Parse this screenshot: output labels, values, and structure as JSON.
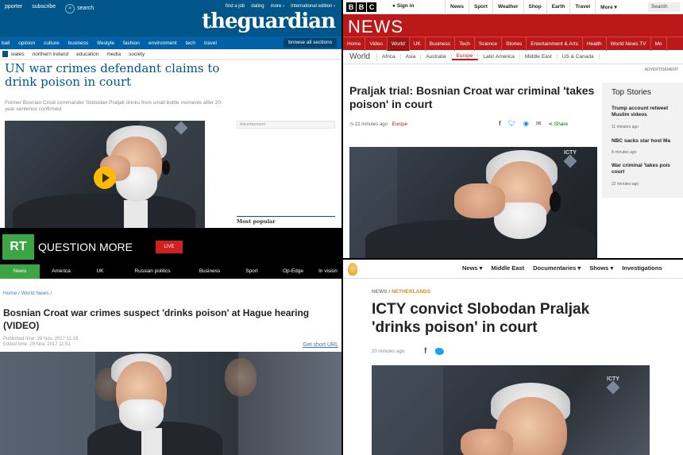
{
  "guardian": {
    "top_links": [
      "pporter",
      "subscribe",
      "search"
    ],
    "right_links": [
      "find a job",
      "dating",
      "more ›",
      "International edition ›"
    ],
    "logo": "theguardian",
    "nav": [
      "ball",
      "opinion",
      "culture",
      "business",
      "lifestyle",
      "fashion",
      "environment",
      "tech",
      "travel"
    ],
    "browse": "browse all sections",
    "subnav": [
      "wales",
      "northern ireland",
      "education",
      "media",
      "society"
    ],
    "headline": "UN war crimes defendant claims to drink poison in court",
    "standfirst": "Former Bosnian Croat commander Slobodan Praljak drinks from small bottle moments after 20-year sentence confirmed",
    "ad_label": "Advertisement",
    "most_popular": "Most popular"
  },
  "bbc": {
    "blocks": [
      "B",
      "B",
      "C"
    ],
    "signin": "Sign in",
    "top_links": [
      "News",
      "Sport",
      "Weather",
      "Shop",
      "Earth",
      "Travel",
      "More ▾"
    ],
    "search": "Search",
    "brand": "NEWS",
    "nav": [
      "Home",
      "Video",
      "World",
      "UK",
      "Business",
      "Tech",
      "Science",
      "Stories",
      "Entertainment & Arts",
      "Health",
      "World News TV",
      "Mo"
    ],
    "nav_active": "World",
    "section": "World",
    "subnav": [
      "Africa",
      "Asia",
      "Australia",
      "Europe",
      "Latin America",
      "Middle East",
      "US & Canada"
    ],
    "subnav_active": "Europe",
    "ad_label": "ADVERTISEMENT",
    "headline": "Praljak trial: Bosnian Croat war criminal 'takes poison' in court",
    "time": "22 minutes ago",
    "time_section": "Europe",
    "share": "Share",
    "top_stories_title": "Top Stories",
    "top_stories": [
      {
        "title": "Trump account retweet Muslim videos",
        "time": "11 minutes ago"
      },
      {
        "title": "NBC sacks star host Ma",
        "time": "8 minutes ago"
      },
      {
        "title": "War criminal 'takes pois court",
        "time": "22 minutes ago"
      }
    ],
    "watermark": "ICTY"
  },
  "rt": {
    "logo": "RT",
    "slogan": "QUESTION MORE",
    "live": "LIVE",
    "nav": [
      "News",
      "America",
      "UK",
      "Russian politics",
      "Business",
      "Sport",
      "Op-Edge",
      "In vision"
    ],
    "nav_active": "News",
    "breadcrumb": "Home / World News /",
    "headline": "Bosnian Croat war crimes suspect 'drinks poison' at Hague hearing (VIDEO)",
    "published": "Published time: 29 Nov, 2017 11:18",
    "edited": "Edited time: 29 Nov, 2017 11:51",
    "short_url": "Get short URL"
  },
  "aljazeera": {
    "nav": [
      "News ▾",
      "Middle East",
      "Documentaries ▾",
      "Shows ▾",
      "Investigations"
    ],
    "kicker_section": "NEWS",
    "kicker_sep": "/",
    "kicker_region": "NETHERLANDS",
    "headline": "ICTY convict Slobodan Praljak 'drinks poison' in court",
    "time": "20 minutes ago",
    "facebook": "f",
    "watermark": "ICTY"
  }
}
